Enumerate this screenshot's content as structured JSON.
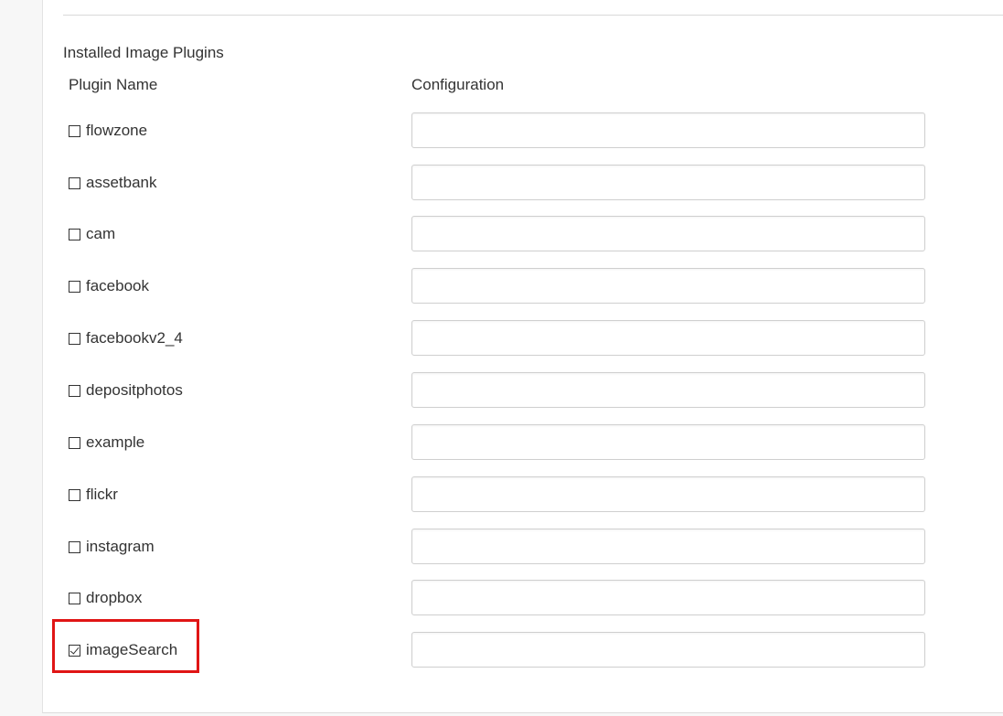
{
  "section": {
    "title": "Installed Image Plugins"
  },
  "columns": {
    "name": "Plugin Name",
    "config": "Configuration"
  },
  "plugins": [
    {
      "name": "flowzone",
      "checked": false,
      "config": ""
    },
    {
      "name": "assetbank",
      "checked": false,
      "config": ""
    },
    {
      "name": "cam",
      "checked": false,
      "config": ""
    },
    {
      "name": "facebook",
      "checked": false,
      "config": ""
    },
    {
      "name": "facebookv2_4",
      "checked": false,
      "config": ""
    },
    {
      "name": "depositphotos",
      "checked": false,
      "config": ""
    },
    {
      "name": "example",
      "checked": false,
      "config": ""
    },
    {
      "name": "flickr",
      "checked": false,
      "config": ""
    },
    {
      "name": "instagram",
      "checked": false,
      "config": ""
    },
    {
      "name": "dropbox",
      "checked": false,
      "config": ""
    },
    {
      "name": "imageSearch",
      "checked": true,
      "config": ""
    }
  ],
  "highlight_color": "#e01515"
}
